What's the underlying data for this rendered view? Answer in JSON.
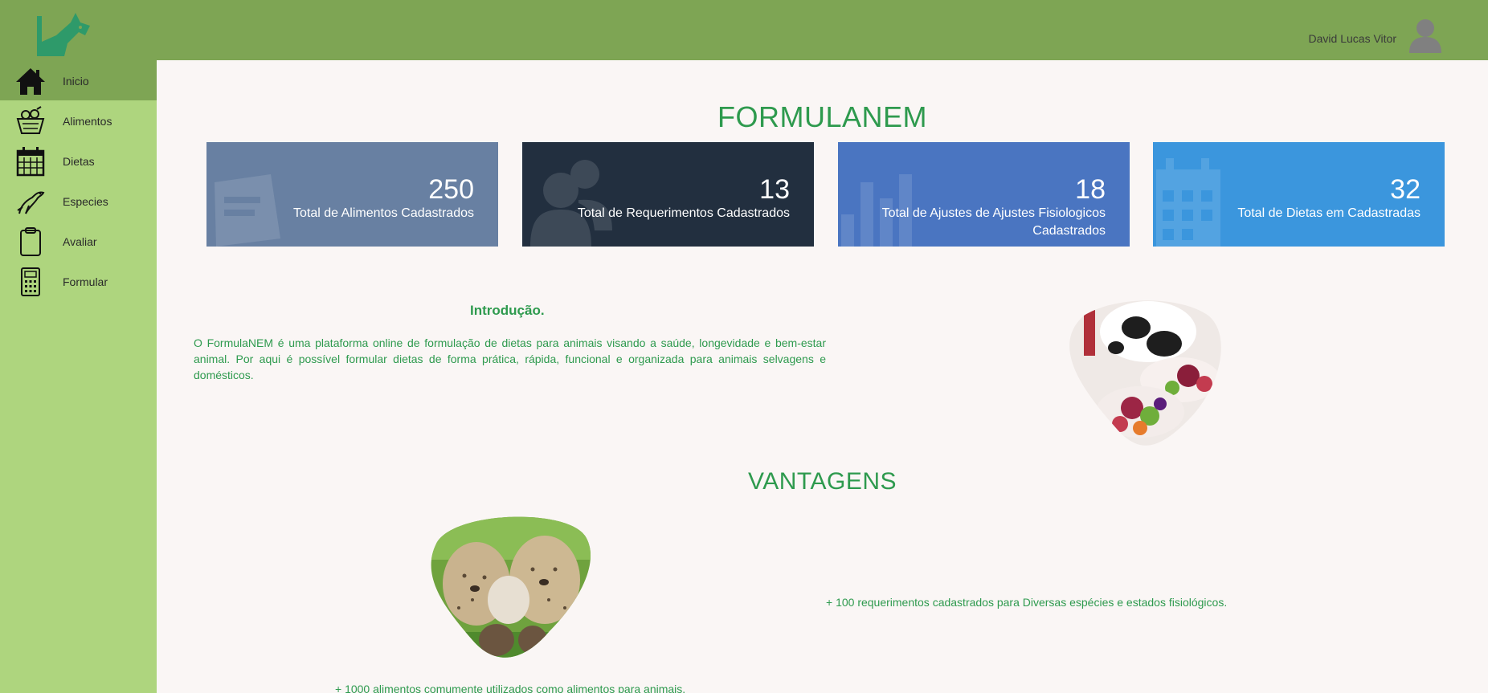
{
  "header": {
    "user_name": "David Lucas Vitor"
  },
  "sidebar": {
    "items": [
      {
        "label": "Inicio",
        "icon": "home-icon",
        "active": true
      },
      {
        "label": "Alimentos",
        "icon": "fruit-basket-icon"
      },
      {
        "label": "Dietas",
        "icon": "calendar-icon"
      },
      {
        "label": "Especies",
        "icon": "animal-icon"
      },
      {
        "label": "Avaliar",
        "icon": "clipboard-icon"
      },
      {
        "label": "Formular",
        "icon": "calculator-icon"
      }
    ]
  },
  "main": {
    "title": "FORMULANEM",
    "cards": [
      {
        "value": "250",
        "caption": "Total de Alimentos Cadastrados",
        "color": "#6880a2",
        "icon": "document-icon"
      },
      {
        "value": "13",
        "caption": "Total de Requerimentos Cadastrados",
        "color": "#222f3f",
        "icon": "users-icon"
      },
      {
        "value": "18",
        "caption": "Total de Ajustes de Ajustes Fisiologicos Cadastrados",
        "color": "#4a75c1",
        "icon": "bar-chart-icon"
      },
      {
        "value": "32",
        "caption": "Total de Dietas em Cadastradas",
        "color": "#3b96dd",
        "icon": "calendar-icon"
      }
    ],
    "intro": {
      "heading": "Introdução.",
      "text": "O FormulaNEM é uma plataforma online de formulação de dietas para animais visando a saúde, longevidade e bem-estar animal. Por aqui é possível formular dietas de forma prática, rápida, funcional e organizada para animais selvagens e domésticos."
    },
    "advantages": {
      "title": "VANTAGENS",
      "item1": "+ 100 requerimentos cadastrados para Diversas espécies e estados fisiológicos.",
      "item2": "+ 1000 alimentos comumente utilizados como alimentos para animais."
    },
    "accent_color": "#2e9a4e"
  }
}
